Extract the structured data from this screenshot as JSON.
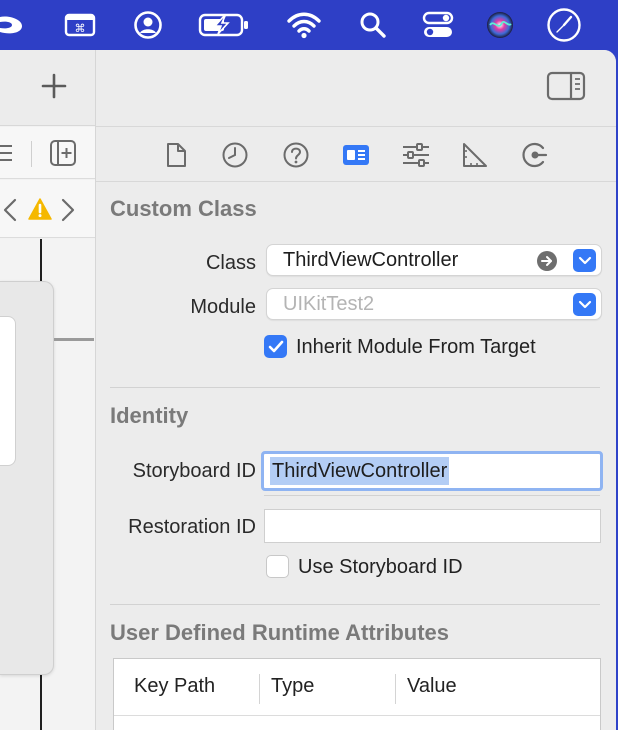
{
  "menubar": {
    "icons": [
      "app-icon",
      "keyboard-viewer-icon",
      "user-account-icon",
      "battery-charging-icon",
      "wifi-icon",
      "spotlight-search-icon",
      "control-center-icon",
      "siri-icon",
      "clock-icon"
    ]
  },
  "editor": {
    "add_label": "+",
    "nav_back": "‹",
    "nav_forward": "›",
    "warning_icon": "warning-icon"
  },
  "inspector": {
    "tabs": [
      "file-inspector",
      "history-inspector",
      "quick-help",
      "identity-inspector",
      "attributes-inspector",
      "size-inspector",
      "connections-inspector"
    ],
    "selected_tab": "identity-inspector",
    "custom_class": {
      "title": "Custom Class",
      "class_label": "Class",
      "class_value": "ThirdViewController",
      "module_label": "Module",
      "module_placeholder": "UIKitTest2",
      "inherit_label": "Inherit Module From Target",
      "inherit_checked": true
    },
    "identity": {
      "title": "Identity",
      "storyboard_id_label": "Storyboard ID",
      "storyboard_id_value": "ThirdViewController",
      "restoration_id_label": "Restoration ID",
      "restoration_id_value": "",
      "use_storyboard_label": "Use Storyboard ID",
      "use_storyboard_checked": false
    },
    "runtime_attributes": {
      "title": "User Defined Runtime Attributes",
      "columns": [
        "Key Path",
        "Type",
        "Value"
      ]
    }
  },
  "colors": {
    "accent": "#3478f6",
    "menubar": "#2e3fc6",
    "warning": "#f5b800"
  }
}
